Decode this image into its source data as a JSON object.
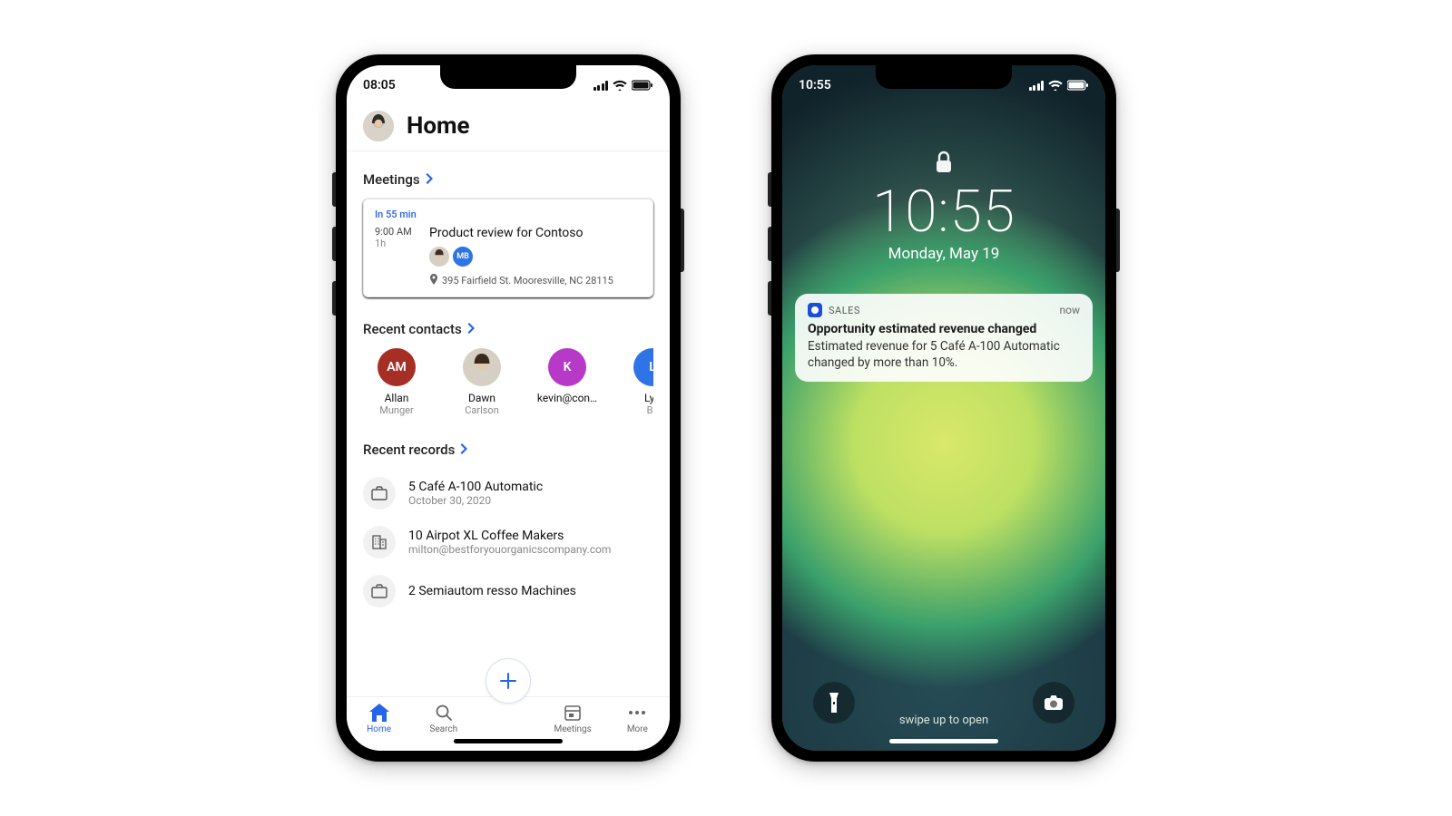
{
  "phone1": {
    "status_time": "08:05",
    "header_title": "Home",
    "sections": {
      "meetings_label": "Meetings",
      "contacts_label": "Recent contacts",
      "records_label": "Recent records"
    },
    "meeting": {
      "badge": "In 55 min",
      "time_start": "9:00 AM",
      "duration": "1h",
      "title": "Product review for Contoso",
      "attendee_badge": "MB",
      "location": "395 Fairfield St. Mooresville, NC 28115"
    },
    "contacts": [
      {
        "initials": "AM",
        "color": "#a52f25",
        "name1": "Allan",
        "name2": "Munger"
      },
      {
        "initials": "",
        "color": "#d8d4cc",
        "name1": "Dawn",
        "name2": "Carlson"
      },
      {
        "initials": "K",
        "color": "#b739c8",
        "name1": "kevin@con…",
        "name2": ""
      },
      {
        "initials": "L",
        "color": "#2f74e6",
        "name1": "Lyd",
        "name2": "Ba"
      }
    ],
    "records": [
      {
        "title": "5 Café A-100 Automatic",
        "sub": "October 30, 2020"
      },
      {
        "title": "10 Airpot XL Coffee Makers",
        "sub": "milton@bestforyouorganicscompany.com"
      },
      {
        "title": "2 Semiautom        resso Machines",
        "sub": ""
      }
    ],
    "nav": {
      "home": "Home",
      "search": "Search",
      "meetings": "Meetings",
      "more": "More"
    }
  },
  "phone2": {
    "status_time": "10:55",
    "big_time": "10:55",
    "big_date": "Monday, May 19",
    "notif": {
      "app": "SALES",
      "when": "now",
      "title": "Opportunity estimated revenue changed",
      "body": "Estimated revenue for 5 Café A-100 Automatic changed by more than 10%."
    },
    "swipe_hint": "swipe up to open"
  }
}
